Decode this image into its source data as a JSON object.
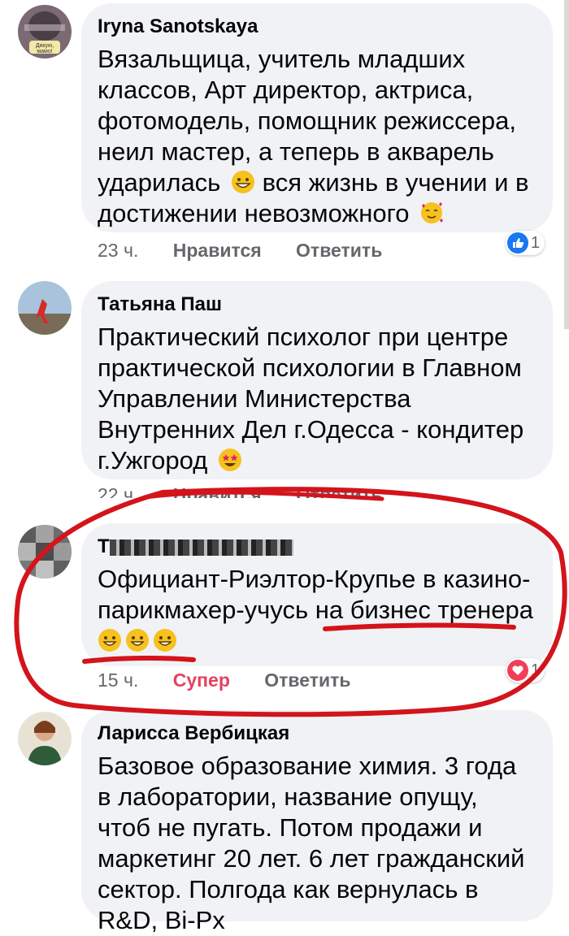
{
  "comments": [
    {
      "author": "Iryna Sanotskaya",
      "text": "Вязальщица, учитель младших классов, Арт директор, актриса, фотомодель, помощник режиссера, неил мастер, а теперь в акварель ударилась",
      "text_tail": "вся жизнь в учении и в достижении невозможного",
      "time": "23 ч.",
      "like_label": "Нравится",
      "reply_label": "Ответить",
      "reaction_count": "1",
      "avatar_caption": "Дякую, мамо!"
    },
    {
      "author": "Татьяна Паш",
      "text": "Практический психолог при центре практической психологии в Главном Управлении Министерства Внутренних Дел г.Одесса - кондитер г.Ужгород",
      "time": "22 ч.",
      "like_label": "Нравится",
      "reply_label": "Ответить"
    },
    {
      "author": "Т",
      "text": "Официант-Риэлтор-Крупье в казино-парикмахер-учусь на бизнес тренера",
      "time": "15 ч.",
      "like_label": "Супер",
      "reply_label": "Ответить",
      "reaction_count": "1"
    },
    {
      "author": "Ларисса Вербицкая",
      "text": "Базовое образование химия. 3 года в лаборатории, название опущу, чтоб не пугать. Потом продажи и маркетинг 20 лет. 6 лет гражданский сектор. Полгода как вернулась в R&D,",
      "text_partial": "Ві-Рх"
    }
  ],
  "colors": {
    "annotation": "#d3141b",
    "super": "#e4405f",
    "like_blue": "#1877f2",
    "love_red": "#f33e58"
  }
}
